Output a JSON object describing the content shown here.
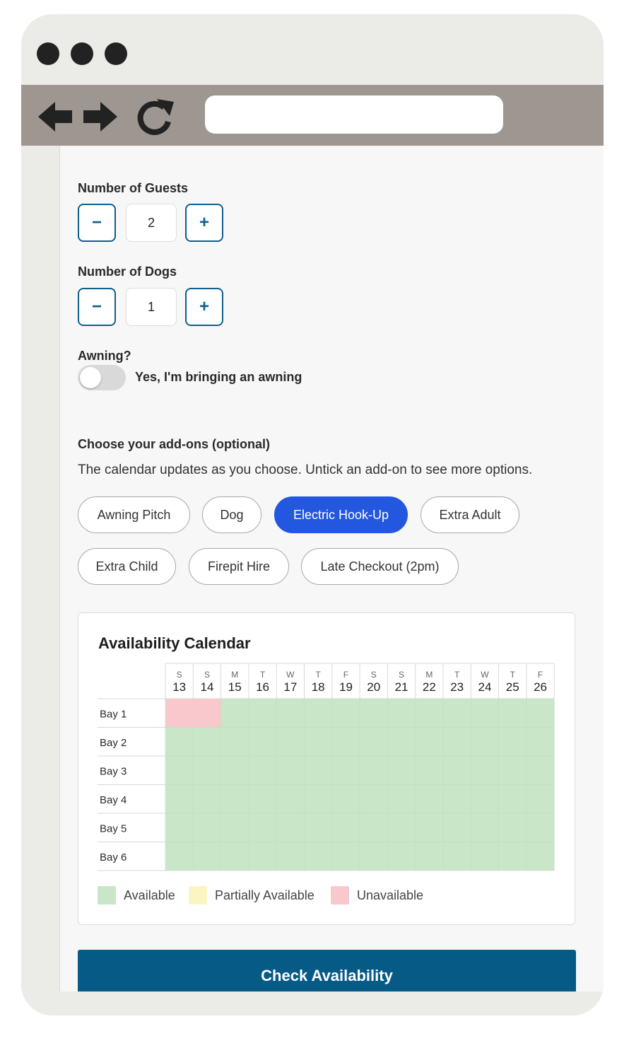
{
  "form": {
    "guests": {
      "label": "Number of Guests",
      "value": "2",
      "minus": "−",
      "plus": "+"
    },
    "dogs": {
      "label": "Number of Dogs",
      "value": "1",
      "minus": "−",
      "plus": "+"
    },
    "awning": {
      "label": "Awning?",
      "toggle_label": "Yes, I'm bringing an awning",
      "on": false
    },
    "addons": {
      "heading": "Choose your add-ons (optional)",
      "description": "The calendar updates as you choose. Untick an add-on to see more options.",
      "chips": [
        {
          "label": "Awning Pitch",
          "selected": false
        },
        {
          "label": "Dog",
          "selected": false
        },
        {
          "label": "Electric Hook-Up",
          "selected": true
        },
        {
          "label": "Extra Adult",
          "selected": false
        },
        {
          "label": "Extra Child",
          "selected": false
        },
        {
          "label": "Firepit Hire",
          "selected": false
        },
        {
          "label": "Late Checkout (2pm)",
          "selected": false
        }
      ]
    },
    "submit_label": "Check Availability"
  },
  "calendar": {
    "title": "Availability Calendar",
    "days": [
      {
        "dow": "S",
        "date": "13"
      },
      {
        "dow": "S",
        "date": "14"
      },
      {
        "dow": "M",
        "date": "15"
      },
      {
        "dow": "T",
        "date": "16"
      },
      {
        "dow": "W",
        "date": "17"
      },
      {
        "dow": "T",
        "date": "18"
      },
      {
        "dow": "F",
        "date": "19"
      },
      {
        "dow": "S",
        "date": "20"
      },
      {
        "dow": "S",
        "date": "21"
      },
      {
        "dow": "M",
        "date": "22"
      },
      {
        "dow": "T",
        "date": "23"
      },
      {
        "dow": "W",
        "date": "24"
      },
      {
        "dow": "T",
        "date": "25"
      },
      {
        "dow": "F",
        "date": "26"
      }
    ],
    "bays": [
      {
        "name": "Bay 1",
        "status": [
          "u",
          "u",
          "a",
          "a",
          "a",
          "a",
          "a",
          "a",
          "a",
          "a",
          "a",
          "a",
          "a",
          "a"
        ]
      },
      {
        "name": "Bay 2",
        "status": [
          "a",
          "a",
          "a",
          "a",
          "a",
          "a",
          "a",
          "a",
          "a",
          "a",
          "a",
          "a",
          "a",
          "a"
        ]
      },
      {
        "name": "Bay 3",
        "status": [
          "a",
          "a",
          "a",
          "a",
          "a",
          "a",
          "a",
          "a",
          "a",
          "a",
          "a",
          "a",
          "a",
          "a"
        ]
      },
      {
        "name": "Bay 4",
        "status": [
          "a",
          "a",
          "a",
          "a",
          "a",
          "a",
          "a",
          "a",
          "a",
          "a",
          "a",
          "a",
          "a",
          "a"
        ]
      },
      {
        "name": "Bay 5",
        "status": [
          "a",
          "a",
          "a",
          "a",
          "a",
          "a",
          "a",
          "a",
          "a",
          "a",
          "a",
          "a",
          "a",
          "a"
        ]
      },
      {
        "name": "Bay 6",
        "status": [
          "a",
          "a",
          "a",
          "a",
          "a",
          "a",
          "a",
          "a",
          "a",
          "a",
          "a",
          "a",
          "a",
          "a"
        ]
      }
    ],
    "legend": [
      {
        "key": "a",
        "label": "Available",
        "color": "#cae6c8"
      },
      {
        "key": "p",
        "label": "Partially Available",
        "color": "#fbf5c4"
      },
      {
        "key": "u",
        "label": "Unavailable",
        "color": "#f9c8cc"
      }
    ]
  },
  "colors": {
    "accent": "#0d5f8c",
    "chip_selected": "#2457e0",
    "cta": "#065a86"
  }
}
